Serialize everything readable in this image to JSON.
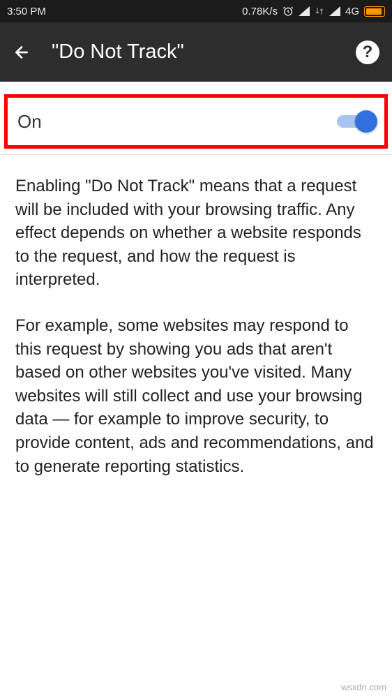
{
  "status_bar": {
    "time": "3:50 PM",
    "network_speed": "0.78K/s",
    "network_type": "4G"
  },
  "app_bar": {
    "title": "\"Do Not Track\"",
    "help_label": "?"
  },
  "toggle": {
    "label": "On",
    "state": "on"
  },
  "description": {
    "paragraph1": "Enabling \"Do Not Track\" means that a request will be included with your browsing traffic. Any effect depends on whether a website responds to the request, and how the request is interpreted.",
    "paragraph2": "For example, some websites may respond to this request by showing you ads that aren't based on other websites you've visited. Many websites will still collect and use your brows­ing data — for example to improve security, to provide content, ads and recommendations, and to generate reporting statistics."
  },
  "watermark": "wsxdn.com"
}
